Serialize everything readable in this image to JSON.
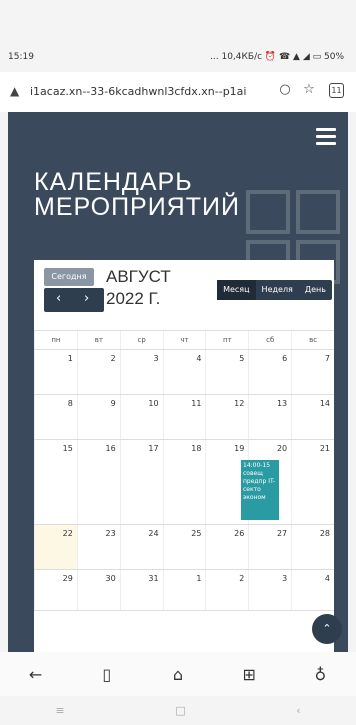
{
  "status": {
    "time": "15:19",
    "indicators": "... 10,4КБ/с ⏰ ☎ ▲ ◢ ▭ 50%"
  },
  "browser": {
    "url": "i1acaz.xn--33-6kcadhwnl3cfdx.xn--p1ai",
    "tab_count": "11"
  },
  "site": {
    "title_line1": "КАЛЕНДАРЬ",
    "title_line2": "МЕРОПРИЯТИЙ"
  },
  "calendar": {
    "today_label": "Сегодня",
    "month_line1": "АВГУСТ",
    "month_line2": "2022 Г.",
    "views": [
      "Месяц",
      "Неделя",
      "День"
    ],
    "weekdays": [
      "пн",
      "вт",
      "ср",
      "чт",
      "пт",
      "сб",
      "вс"
    ],
    "weeks": [
      [
        "1",
        "2",
        "3",
        "4",
        "5",
        "6",
        "7"
      ],
      [
        "8",
        "9",
        "10",
        "11",
        "12",
        "13",
        "14"
      ],
      [
        "15",
        "16",
        "17",
        "18",
        "19",
        "20",
        "21"
      ],
      [
        "22",
        "23",
        "24",
        "25",
        "26",
        "27",
        "28"
      ],
      [
        "29",
        "30",
        "31",
        "1",
        "2",
        "3",
        "4"
      ]
    ],
    "event_text": "14:00-15 совещ предпр IT-секто эконом"
  },
  "icons": {
    "back": "back-arrow-icon",
    "bookmarks": "book-icon",
    "home": "home-icon",
    "tabs": "tabs-icon",
    "profile": "profile-icon"
  }
}
